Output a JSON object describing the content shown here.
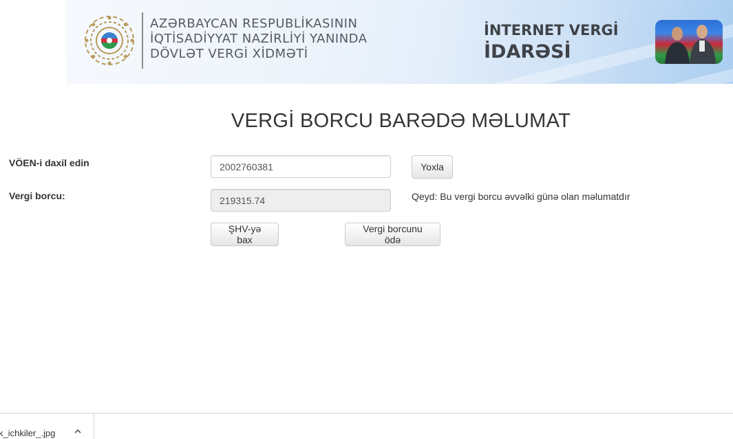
{
  "banner": {
    "ministry_lines": [
      "AZƏRBAYCAN RESPUBLİKASININ",
      "İQTİSADİYYAT NAZİRLİYİ YANINDA",
      "DÖVLƏT VERGİ XİDMƏTİ"
    ],
    "service_line1": "İNTERNET VERGİ",
    "service_line2": "İDARƏSİ"
  },
  "page_title": "VERGİ BORCU BARƏDƏ MƏLUMAT",
  "form": {
    "voen_label": "VÖEN-i daxil edin",
    "voen_value": "2002760381",
    "check_button": "Yoxla",
    "debt_label": "Vergi borcu:",
    "debt_value": "219315.74",
    "note": "Qeyd: Bu vergi borcu əvvəlki günə olan məlumatdır",
    "shv_button": "ŞHV-yə bax",
    "pay_button": "Vergi borcunu ödə"
  },
  "download_bar": {
    "file_name": "k_ichkiler_.jpg"
  },
  "colors": {
    "banner_text": "#555a60",
    "banner_accent": "#a9cdf0",
    "readonly_bg": "#eeeeee"
  }
}
